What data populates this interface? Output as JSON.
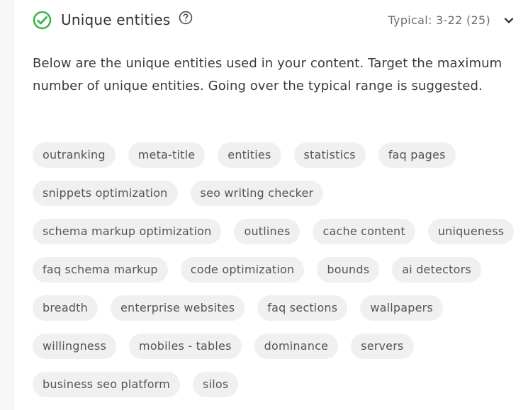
{
  "header": {
    "title": "Unique entities",
    "typical_label": "Typical:  3-22  (25)",
    "icons": {
      "status": "check-circle-icon",
      "help": "question-circle-icon",
      "toggle": "chevron-down-icon"
    }
  },
  "description": "Below are the unique entities used in your content. Target the maximum number of unique entities. Going over the typical range is suggested.",
  "entities": [
    "outranking",
    "meta-title",
    "entities",
    "statistics",
    "faq pages",
    "snippets optimization",
    "seo writing checker",
    "schema markup optimization",
    "outlines",
    "cache content",
    "uniqueness",
    "faq schema markup",
    "code optimization",
    "bounds",
    "ai detectors",
    "breadth",
    "enterprise websites",
    "faq sections",
    "wallpapers",
    "willingness",
    "mobiles - tables",
    "dominance",
    "servers",
    "business seo platform",
    "silos"
  ],
  "colors": {
    "accent_green": "#3bb54a",
    "tag_background": "#f0f0f0"
  }
}
